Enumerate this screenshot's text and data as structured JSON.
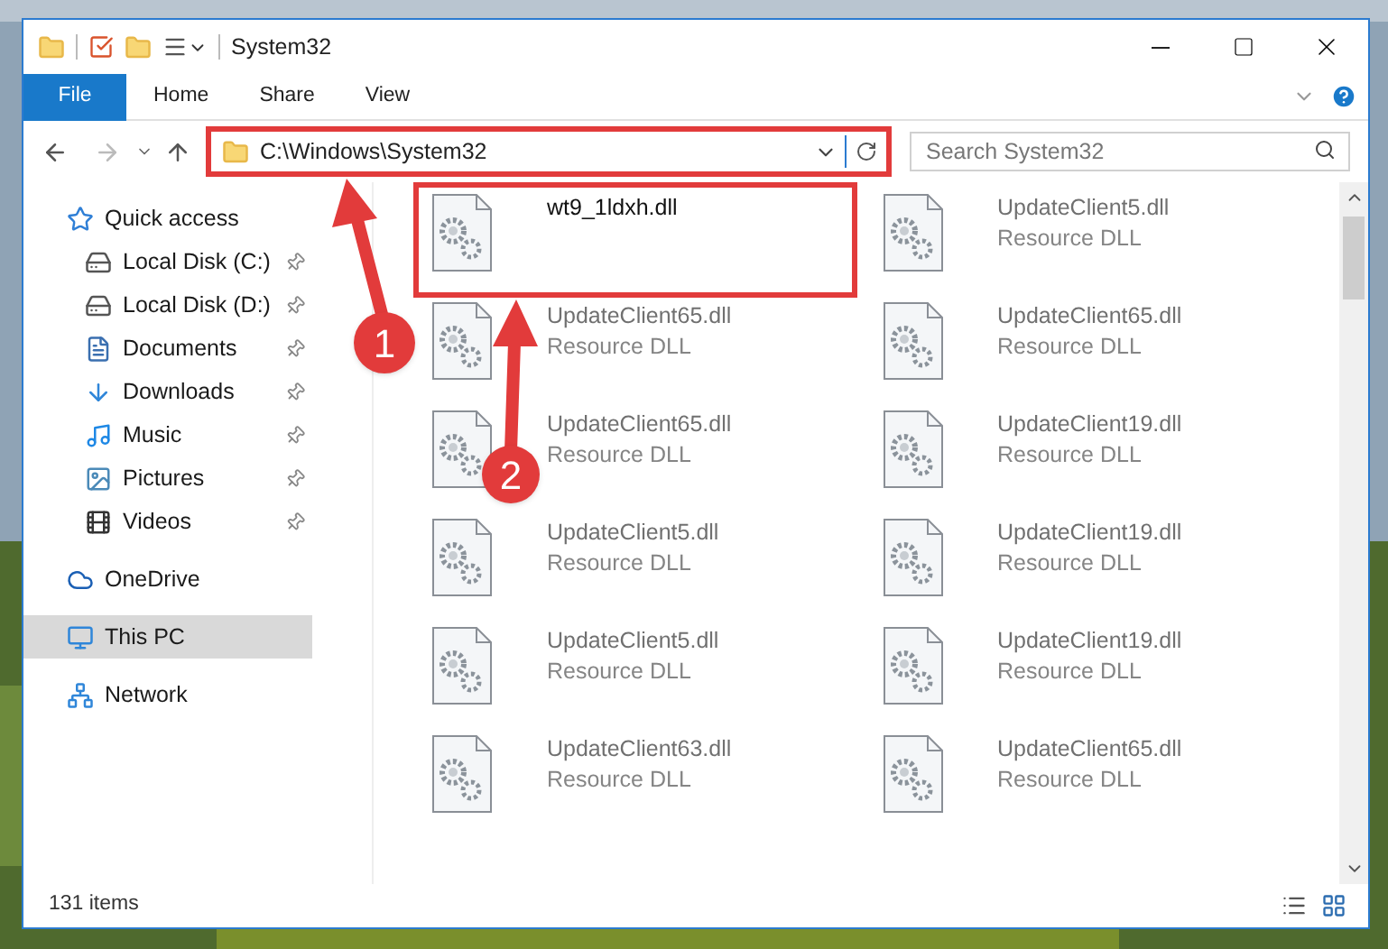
{
  "window": {
    "title": "System32"
  },
  "ribbon_tabs": [
    {
      "label": "File",
      "selected": true
    },
    {
      "label": "Home",
      "selected": false
    },
    {
      "label": "Share",
      "selected": false
    },
    {
      "label": "View",
      "selected": false
    }
  ],
  "address_bar": {
    "path": "C:\\Windows\\System32",
    "highlighted": true
  },
  "search": {
    "placeholder": "Search System32"
  },
  "sidebar": {
    "items": [
      {
        "label": "Quick access",
        "kind": "quick",
        "selected": false,
        "pinned": false,
        "children": [
          {
            "label": "Local Disk (C:)",
            "kind": "diskc",
            "selected": false,
            "pinned": true
          },
          {
            "label": "Local Disk (D:)",
            "kind": "disk",
            "selected": false,
            "pinned": true
          },
          {
            "label": "Documents",
            "kind": "documents",
            "selected": false,
            "pinned": true
          },
          {
            "label": "Downloads",
            "kind": "downloads",
            "selected": false,
            "pinned": true
          },
          {
            "label": "Music",
            "kind": "music",
            "selected": false,
            "pinned": true
          },
          {
            "label": "Pictures",
            "kind": "pictures",
            "selected": false,
            "pinned": true
          },
          {
            "label": "Videos",
            "kind": "videos",
            "selected": false,
            "pinned": true
          }
        ]
      },
      {
        "label": "OneDrive",
        "kind": "cloud",
        "selected": false,
        "pinned": false
      },
      {
        "label": "This PC",
        "kind": "pc",
        "selected": true,
        "pinned": false
      },
      {
        "label": "Network",
        "kind": "network",
        "selected": false,
        "pinned": false
      }
    ]
  },
  "files": [
    {
      "name": "wt9_1ldxh.dll",
      "highlighted": true,
      "blurred": false
    },
    {
      "name": "UpdateClient5.dll",
      "type": "Resource DLL",
      "highlighted": false,
      "blurred": true
    },
    {
      "name": "UpdateClient65.dll",
      "type": "Resource DLL",
      "highlighted": false,
      "blurred": true
    },
    {
      "name": "UpdateClient65.dll",
      "type": "Resource DLL",
      "highlighted": false,
      "blurred": true
    },
    {
      "name": "UpdateClient65.dll",
      "type": "Resource DLL",
      "highlighted": false,
      "blurred": true
    },
    {
      "name": "UpdateClient19.dll",
      "type": "Resource DLL",
      "highlighted": false,
      "blurred": true
    },
    {
      "name": "UpdateClient5.dll",
      "type": "Resource DLL",
      "highlighted": false,
      "blurred": true
    },
    {
      "name": "UpdateClient19.dll",
      "type": "Resource DLL",
      "highlighted": false,
      "blurred": true
    },
    {
      "name": "UpdateClient5.dll",
      "type": "Resource DLL",
      "highlighted": false,
      "blurred": true
    },
    {
      "name": "UpdateClient19.dll",
      "type": "Resource DLL",
      "highlighted": false,
      "blurred": true
    },
    {
      "name": "UpdateClient63.dll",
      "type": "Resource DLL",
      "highlighted": false,
      "blurred": true
    },
    {
      "name": "UpdateClient65.dll",
      "type": "Resource DLL",
      "highlighted": false,
      "blurred": true
    }
  ],
  "annotations": [
    {
      "number": "1"
    },
    {
      "number": "2"
    }
  ],
  "status_bar": {
    "item_count": "131 items"
  }
}
